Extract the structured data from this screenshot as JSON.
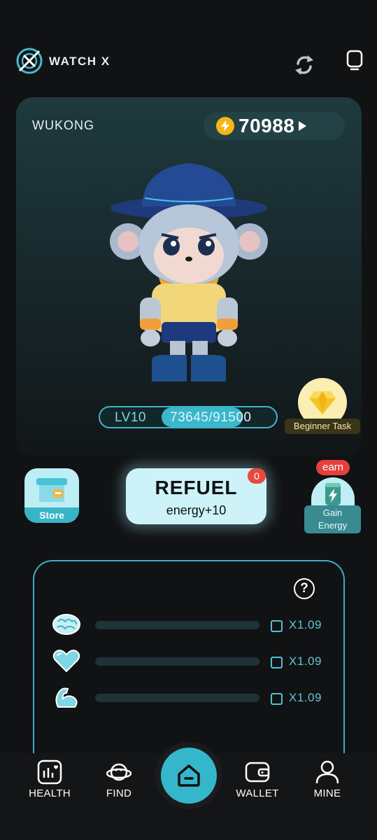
{
  "header": {
    "app_name": "WATCH X",
    "logo_icon": "watch-x-logo-icon",
    "refresh_icon": "sync-icon",
    "watch_icon": "smartwatch-icon"
  },
  "character": {
    "name": "WUKONG",
    "coins": "70988",
    "level_label": "LV10",
    "xp": "73645/91500",
    "xp_progress": 0.805
  },
  "beginner_task": {
    "label": "Beginner Task",
    "icon": "diamond-icon"
  },
  "store": {
    "label": "Store",
    "icon": "store-icon"
  },
  "refuel": {
    "title": "REFUEL",
    "subtitle": "energy+10",
    "badge": "0"
  },
  "gain_energy": {
    "badge": "earn",
    "label_line1": "Gain",
    "label_line2": "Energy",
    "icon": "energy-can-icon"
  },
  "stats": {
    "help_label": "?",
    "rows": [
      {
        "icon": "brain-icon",
        "multiplier": "X1.09",
        "progress": 0
      },
      {
        "icon": "heart-icon",
        "multiplier": "X1.09",
        "progress": 0
      },
      {
        "icon": "muscle-icon",
        "multiplier": "X1.09",
        "progress": 0
      }
    ]
  },
  "nav": {
    "items": [
      {
        "label": "HEALTH",
        "icon": "health-chart-icon"
      },
      {
        "label": "FIND",
        "icon": "planet-icon"
      },
      {
        "label": "WALLET",
        "icon": "wallet-icon"
      },
      {
        "label": "MINE",
        "icon": "user-icon"
      }
    ],
    "home_icon": "home-icon"
  },
  "colors": {
    "accent": "#3ab7cb",
    "background": "#111214",
    "coin": "#f5b716",
    "badge": "#e84a3f"
  }
}
